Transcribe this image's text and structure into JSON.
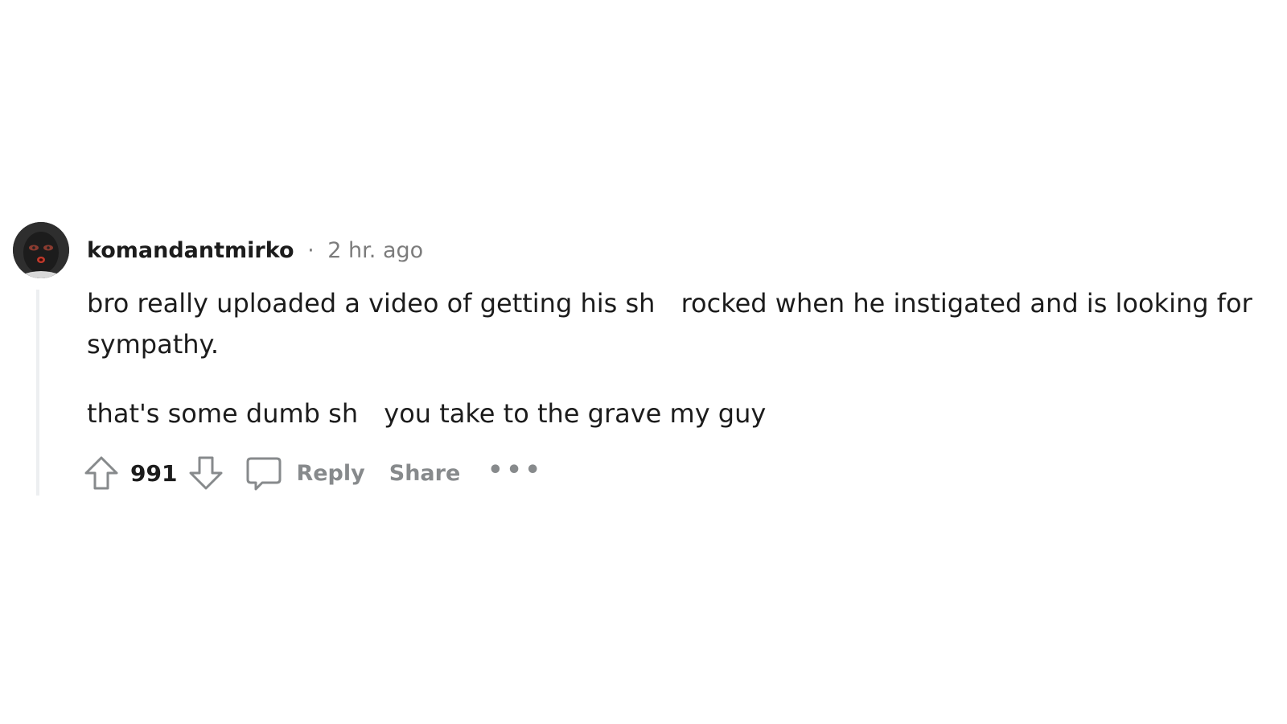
{
  "comment": {
    "author": "komandantmirko",
    "separator": "·",
    "timestamp": "2 hr. ago",
    "body": {
      "p1_a": "bro really uploaded a video of getting his sh",
      "p1_b": " rocked when he instigated and is looking for sympathy.",
      "p2_a": "that's some dumb sh",
      "p2_b": " you take to the grave my guy"
    },
    "actions": {
      "score": "991",
      "reply_label": "Reply",
      "share_label": "Share",
      "more_label": "•••"
    },
    "icons": {
      "avatar": "avatar-balaclava",
      "upvote": "upvote-arrow-icon",
      "downvote": "downvote-arrow-icon",
      "reply": "comment-bubble-icon"
    },
    "colors": {
      "text": "#1c1c1c",
      "muted": "#878a8c",
      "thread_line": "#edeff1"
    }
  }
}
